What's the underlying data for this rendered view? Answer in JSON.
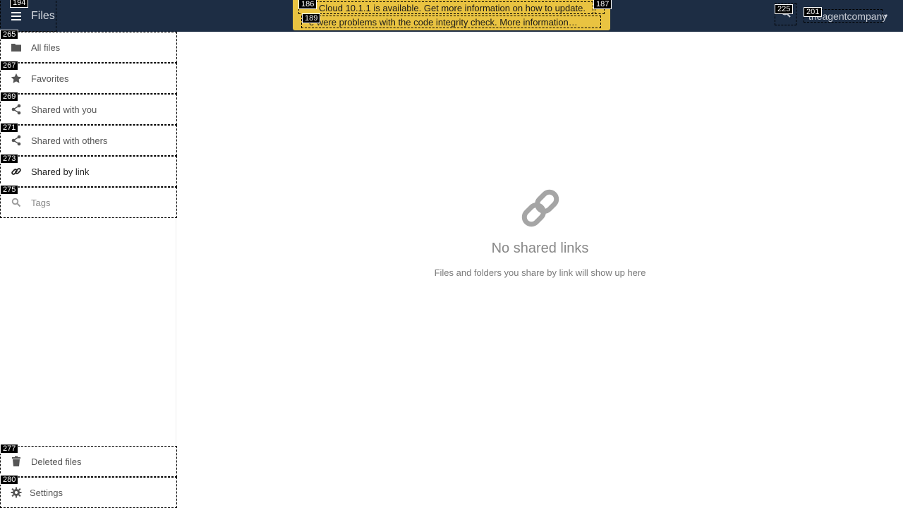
{
  "header": {
    "app_title": "Files",
    "user_name": "theagentcompany",
    "markers": {
      "app_menu": "194",
      "notif_update": "186",
      "notif_close": "187",
      "notif_integrity": "189",
      "search": "225",
      "user_menu": "201"
    }
  },
  "notifications": {
    "update_text": "Cloud 10.1.1 is available. Get more information on how to update.",
    "integrity_text": "e were problems with the code integrity check. More information…"
  },
  "sidebar": {
    "items": [
      {
        "marker": "265",
        "label": "All files",
        "icon": "folder-icon"
      },
      {
        "marker": "267",
        "label": "Favorites",
        "icon": "star-icon"
      },
      {
        "marker": "269",
        "label": "Shared with you",
        "icon": "share-icon"
      },
      {
        "marker": "271",
        "label": "Shared with others",
        "icon": "share-icon"
      },
      {
        "marker": "273",
        "label": "Shared by link",
        "icon": "link-icon",
        "active": true
      },
      {
        "marker": "275",
        "label": "Tags",
        "icon": "search-icon"
      }
    ],
    "deleted": {
      "marker": "277",
      "label": "Deleted files",
      "icon": "trash-icon"
    },
    "settings": {
      "marker": "280",
      "label": "Settings",
      "icon": "gear-icon"
    }
  },
  "main": {
    "empty_title": "No shared links",
    "empty_description": "Files and folders you share by link will show up here",
    "empty_icon": "link-icon"
  },
  "colors": {
    "header_bg": "#1d2d44",
    "notification_bg": "#e9c341"
  }
}
